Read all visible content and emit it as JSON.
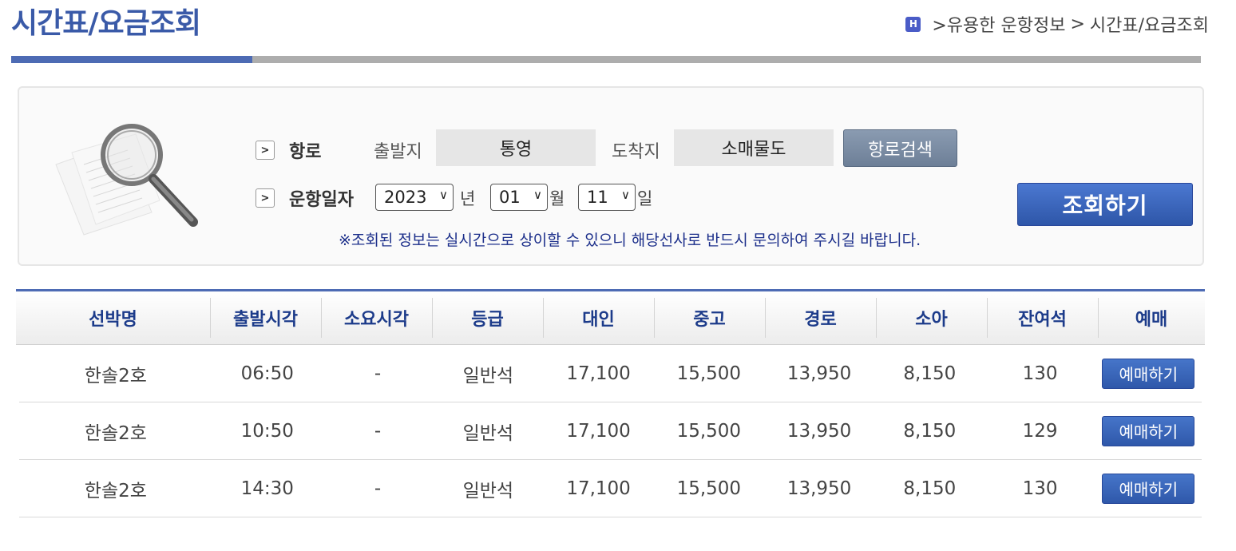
{
  "header": {
    "title": "시간표/요금조회",
    "breadcrumb_icon": "H",
    "breadcrumb": [
      ">유용한 운항정보",
      ">",
      "시간표/요금조회"
    ]
  },
  "search": {
    "route_label": "항로",
    "departure_label": "출발지",
    "departure_value": "통영",
    "arrival_label": "도착지",
    "arrival_value": "소매물도",
    "route_search_button": "항로검색",
    "date_label": "운항일자",
    "year": "2023",
    "year_unit": "년",
    "month": "01",
    "month_unit": "월",
    "day": "11",
    "day_unit": "일",
    "query_button": "조회하기",
    "notice": "※조회된 정보는 실시간으로 상이할 수 있으니 해당선사로 반드시 문의하여 주시길 바랍니다."
  },
  "table": {
    "headers": [
      "선박명",
      "출발시각",
      "소요시각",
      "등급",
      "대인",
      "중고",
      "경로",
      "소아",
      "잔여석",
      "예매"
    ],
    "rows": [
      [
        "한솔2호",
        "06:50",
        "-",
        "일반석",
        "17,100",
        "15,500",
        "13,950",
        "8,150",
        "130",
        "예매하기"
      ],
      [
        "한솔2호",
        "10:50",
        "-",
        "일반석",
        "17,100",
        "15,500",
        "13,950",
        "8,150",
        "129",
        "예매하기"
      ],
      [
        "한솔2호",
        "14:30",
        "-",
        "일반석",
        "17,100",
        "15,500",
        "13,950",
        "8,150",
        "130",
        "예매하기"
      ]
    ]
  },
  "colors": {
    "brand": "#4d6bb4",
    "header_text": "#1c3b8a",
    "notice_text": "#1b2e8a"
  }
}
